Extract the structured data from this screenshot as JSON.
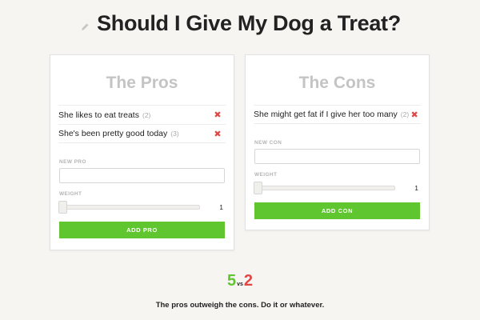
{
  "title": "Should I Give My Dog a Treat?",
  "icons": {
    "title_icon": "pencil-icon",
    "delete": "close-x-icon"
  },
  "pros": {
    "heading": "The Pros",
    "items": [
      {
        "text": "She likes to eat treats",
        "weight": "(2)"
      },
      {
        "text": "She's been pretty good today",
        "weight": "(3)"
      }
    ],
    "new_label": "NEW PRO",
    "new_value": "",
    "weight_label": "WEIGHT",
    "weight_value": "1",
    "button_label": "ADD PRO"
  },
  "cons": {
    "heading": "The Cons",
    "items": [
      {
        "text": "She might get fat if I give her too many",
        "weight": "(2)"
      }
    ],
    "new_label": "NEW CON",
    "new_value": "",
    "weight_label": "WEIGHT",
    "weight_value": "1",
    "button_label": "ADD CON"
  },
  "score": {
    "pros": "5",
    "vs": "vs",
    "cons": "2"
  },
  "verdict": "The pros outweigh the cons. Do it or whatever.",
  "colors": {
    "accent_green": "#5fc62f",
    "delete_red": "#e04848",
    "heading_gray": "#c4c4c4",
    "background": "#f6f5f2"
  }
}
